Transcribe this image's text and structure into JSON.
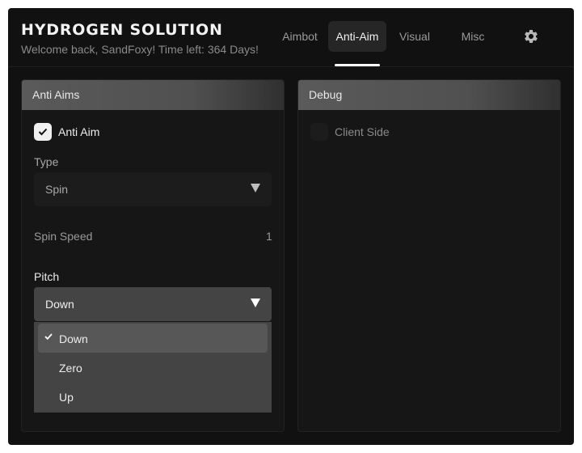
{
  "header": {
    "title": "HYDROGEN SOLUTION",
    "subtitle": "Welcome back, SandFoxy! Time left: 364 Days!"
  },
  "tabs": [
    {
      "label": "Aimbot",
      "active": false
    },
    {
      "label": "Anti-Aim",
      "active": true
    },
    {
      "label": "Visual",
      "active": false
    },
    {
      "label": "Misc",
      "active": false
    }
  ],
  "settings_icon": "gear-icon",
  "anti_aims": {
    "title": "Anti Aims",
    "anti_aim": {
      "label": "Anti Aim",
      "checked": true
    },
    "type": {
      "label": "Type",
      "value": "Spin"
    },
    "spin_speed": {
      "label": "Spin Speed",
      "value": "1"
    },
    "pitch": {
      "label": "Pitch",
      "value": "Down",
      "options": [
        {
          "label": "Down",
          "selected": true
        },
        {
          "label": "Zero",
          "selected": false
        },
        {
          "label": "Up",
          "selected": false
        }
      ]
    }
  },
  "debug": {
    "title": "Debug",
    "client_side": {
      "label": "Client Side",
      "checked": false
    }
  },
  "colors": {
    "background": "#111111",
    "panel": "#161616",
    "accent": "#ffffff",
    "dropdown": "#444444"
  }
}
